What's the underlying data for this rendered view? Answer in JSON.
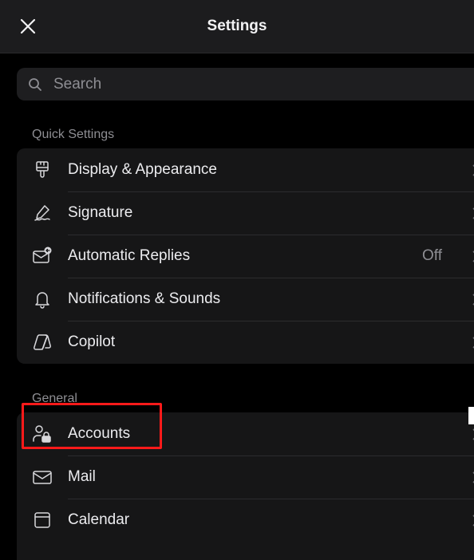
{
  "header": {
    "title": "Settings",
    "close_icon": "close-icon"
  },
  "search": {
    "placeholder": "Search",
    "icon": "search-icon"
  },
  "quick_settings": {
    "label": "Quick Settings",
    "items": [
      {
        "label": "Display & Appearance",
        "icon": "paintbrush-icon",
        "value": ""
      },
      {
        "label": "Signature",
        "icon": "signature-pen-icon",
        "value": ""
      },
      {
        "label": "Automatic Replies",
        "icon": "auto-reply-mail-icon",
        "value": "Off"
      },
      {
        "label": "Notifications & Sounds",
        "icon": "bell-icon",
        "value": ""
      },
      {
        "label": "Copilot",
        "icon": "copilot-icon",
        "value": ""
      }
    ]
  },
  "general": {
    "label": "General",
    "items": [
      {
        "label": "Accounts",
        "icon": "account-lock-icon"
      },
      {
        "label": "Mail",
        "icon": "envelope-icon"
      },
      {
        "label": "Calendar",
        "icon": "calendar-icon"
      }
    ]
  },
  "colors": {
    "background": "#000000",
    "header_bg": "#1c1c1e",
    "group_bg": "#161617",
    "highlight": "#ff1a1a",
    "secondary_text": "#8e8e93"
  }
}
